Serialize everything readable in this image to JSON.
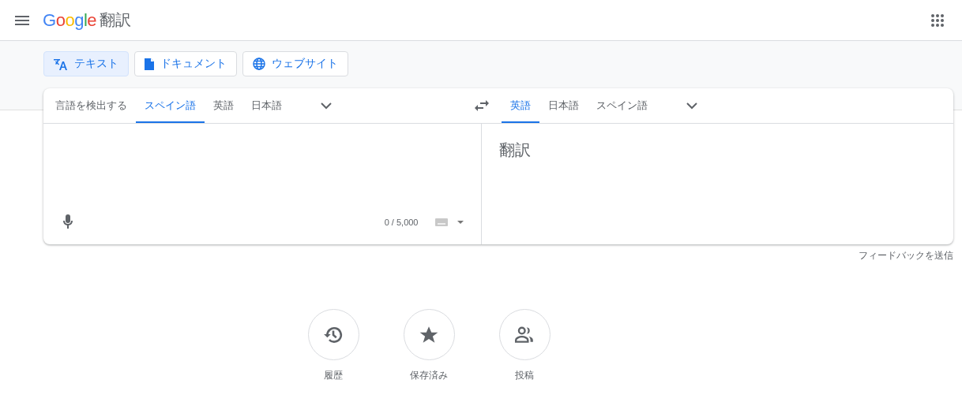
{
  "header": {
    "logo": "Google",
    "title": "翻訳"
  },
  "modes": [
    {
      "label": "テキスト",
      "selected": true
    },
    {
      "label": "ドキュメント",
      "selected": false
    },
    {
      "label": "ウェブサイト",
      "selected": false
    }
  ],
  "source": {
    "tabs": [
      {
        "label": "言語を検出する",
        "selected": false
      },
      {
        "label": "スペイン語",
        "selected": true
      },
      {
        "label": "英語",
        "selected": false
      },
      {
        "label": "日本語",
        "selected": false
      }
    ],
    "counter": "0 / 5,000"
  },
  "target": {
    "tabs": [
      {
        "label": "英語",
        "selected": true
      },
      {
        "label": "日本語",
        "selected": false
      },
      {
        "label": "スペイン語",
        "selected": false
      }
    ],
    "translation": "翻訳"
  },
  "feedback": "フィードバックを送信",
  "shortcuts": [
    {
      "label": "履歴"
    },
    {
      "label": "保存済み"
    },
    {
      "label": "投稿"
    }
  ]
}
